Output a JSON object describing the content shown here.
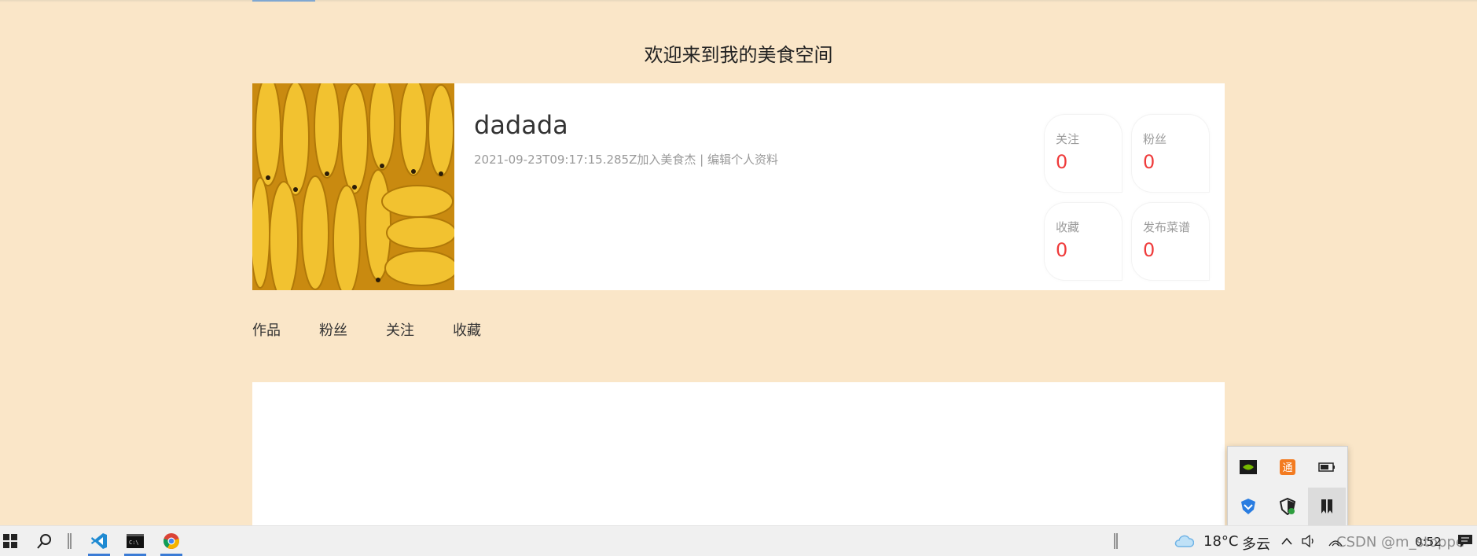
{
  "page": {
    "title": "欢迎来到我的美食空间"
  },
  "profile": {
    "avatar_alt": "bananas",
    "username": "dadada",
    "joined": "2021-09-23T09:17:15.285Z加入美食杰",
    "separator": " | ",
    "edit_link": "编辑个人资料"
  },
  "stats": [
    {
      "label": "关注",
      "value": "0"
    },
    {
      "label": "粉丝",
      "value": "0"
    },
    {
      "label": "收藏",
      "value": "0"
    },
    {
      "label": "发布菜谱",
      "value": "0"
    }
  ],
  "tabs": [
    {
      "label": "作品"
    },
    {
      "label": "粉丝"
    },
    {
      "label": "关注"
    },
    {
      "label": "收藏"
    }
  ],
  "colors": {
    "background": "#fae6c8",
    "accent_number": "#ef3b3b",
    "taskbar_active": "#3a7bd5"
  },
  "tray_popup": {
    "icons": [
      "nvidia-icon",
      "app-orange-icon",
      "battery-icon",
      "shield-blue-icon",
      "security-shield-icon",
      "bookmark-icon"
    ]
  },
  "taskbar": {
    "apps": [
      "windows-start-icon",
      "search-icon",
      "vscode-icon",
      "terminal-icon",
      "chrome-icon"
    ],
    "weather_temp": "18°C",
    "weather_desc": "多云",
    "time": "0:52",
    "watermark": "CSDN @m_stoppe"
  }
}
